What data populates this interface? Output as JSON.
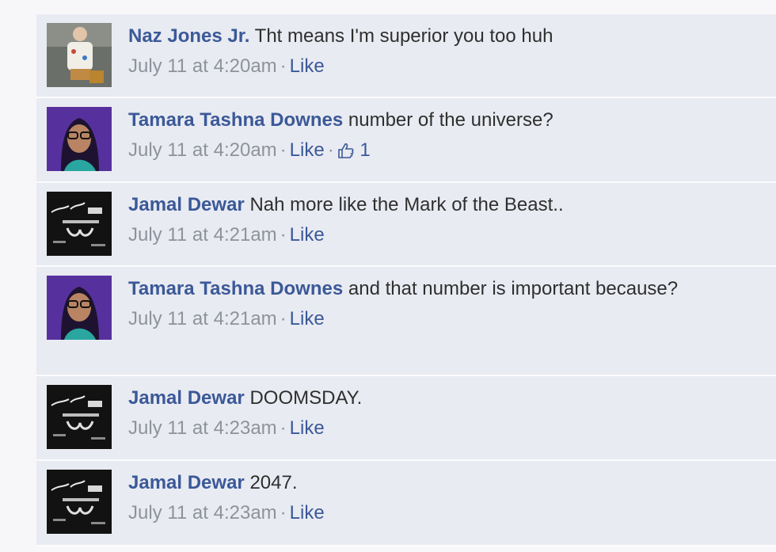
{
  "comments": [
    {
      "author": "Naz Jones Jr.",
      "text": "Tht means I'm superior you too huh",
      "time": "July 11 at 4:20am",
      "like_label": "Like",
      "avatar": "photo-child"
    },
    {
      "author": "Tamara Tashna Downes",
      "text": "number of the universe?",
      "time": "July 11 at 4:20am",
      "like_label": "Like",
      "like_count": "1",
      "avatar": "photo-woman-glasses"
    },
    {
      "author": "Jamal Dewar",
      "text": "Nah more like the Mark of the Beast..",
      "time": "July 11 at 4:21am",
      "like_label": "Like",
      "avatar": "photo-dark-logo"
    },
    {
      "author": "Tamara Tashna Downes",
      "text": "and that number is important because?",
      "time": "July 11 at 4:21am",
      "like_label": "Like",
      "avatar": "photo-woman-glasses"
    },
    {
      "author": "Jamal Dewar",
      "text": "DOOMSDAY.",
      "time": "July 11 at 4:23am",
      "like_label": "Like",
      "avatar": "photo-dark-logo"
    },
    {
      "author": "Jamal Dewar",
      "text": "2047.",
      "time": "July 11 at 4:23am",
      "like_label": "Like",
      "avatar": "photo-dark-logo"
    }
  ],
  "separator": "·",
  "colors": {
    "author": "#3b5998",
    "comment_bg": "#e9ebf2",
    "meta": "#8e929c"
  }
}
